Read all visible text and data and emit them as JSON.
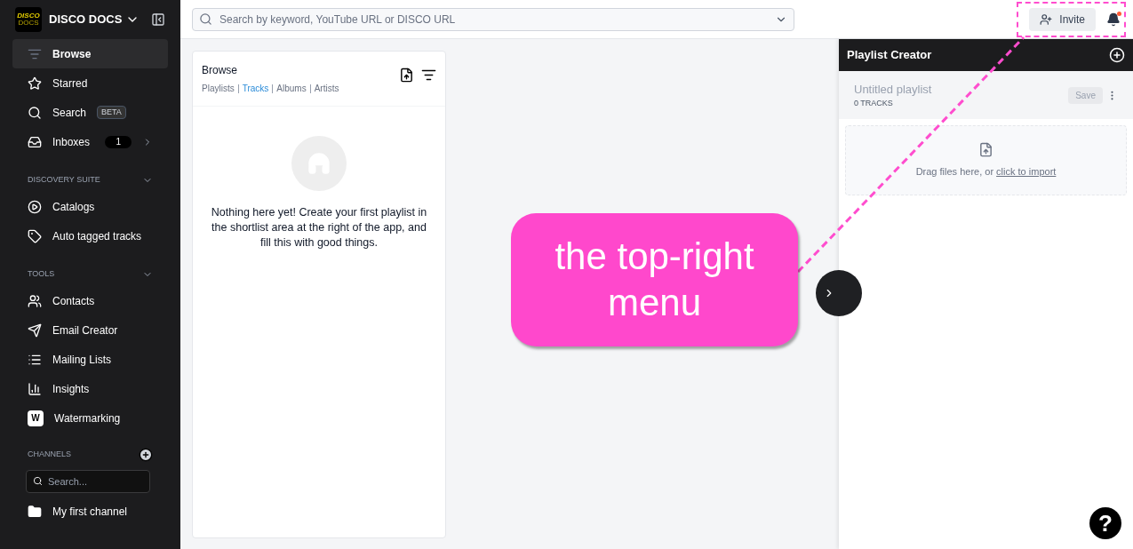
{
  "sidebar": {
    "brand": "DISCO DOCS",
    "logo_text": [
      "DISCO",
      "DOCS"
    ],
    "nav": [
      {
        "label": "Browse",
        "selected": true
      },
      {
        "label": "Starred",
        "selected": false
      },
      {
        "label": "Search",
        "selected": false,
        "badge": "BETA"
      },
      {
        "label": "Inboxes",
        "selected": false,
        "count": "1"
      }
    ],
    "sections": [
      {
        "title": "DISCOVERY SUITE",
        "expanded": true,
        "items": [
          {
            "label": "Catalogs"
          },
          {
            "label": "Auto tagged tracks"
          }
        ]
      },
      {
        "title": "TOOLS",
        "expanded": true,
        "items": [
          {
            "label": "Contacts"
          },
          {
            "label": "Email Creator"
          },
          {
            "label": "Mailing Lists"
          },
          {
            "label": "Insights"
          },
          {
            "label": "Watermarking",
            "icon_text": "W"
          }
        ]
      }
    ],
    "channels": {
      "title": "CHANNELS",
      "search_placeholder": "Search...",
      "items": [
        {
          "label": "My first channel"
        }
      ]
    }
  },
  "topbar": {
    "search_placeholder": "Search by keyword, YouTube URL or DISCO URL",
    "invite": "Invite",
    "notification_dot": true
  },
  "browse": {
    "title": "Browse",
    "tabs": [
      {
        "label": "Playlists",
        "selected": false
      },
      {
        "label": "Tracks",
        "selected": true
      },
      {
        "label": "Albums",
        "selected": false
      },
      {
        "label": "Artists",
        "selected": false
      }
    ],
    "empty_text": "Nothing here yet! Create your first playlist in the shortlist area at the right of the app, and fill this with good things."
  },
  "playlist_creator": {
    "title": "Playlist Creator",
    "name_placeholder": "Untitled playlist",
    "track_count": "0 TRACKS",
    "save": "Save",
    "save_disabled": true,
    "drop_text": "Drag files here, or ",
    "drop_link": "click to import"
  },
  "help": "?",
  "callout": {
    "text": "the top-right menu"
  }
}
